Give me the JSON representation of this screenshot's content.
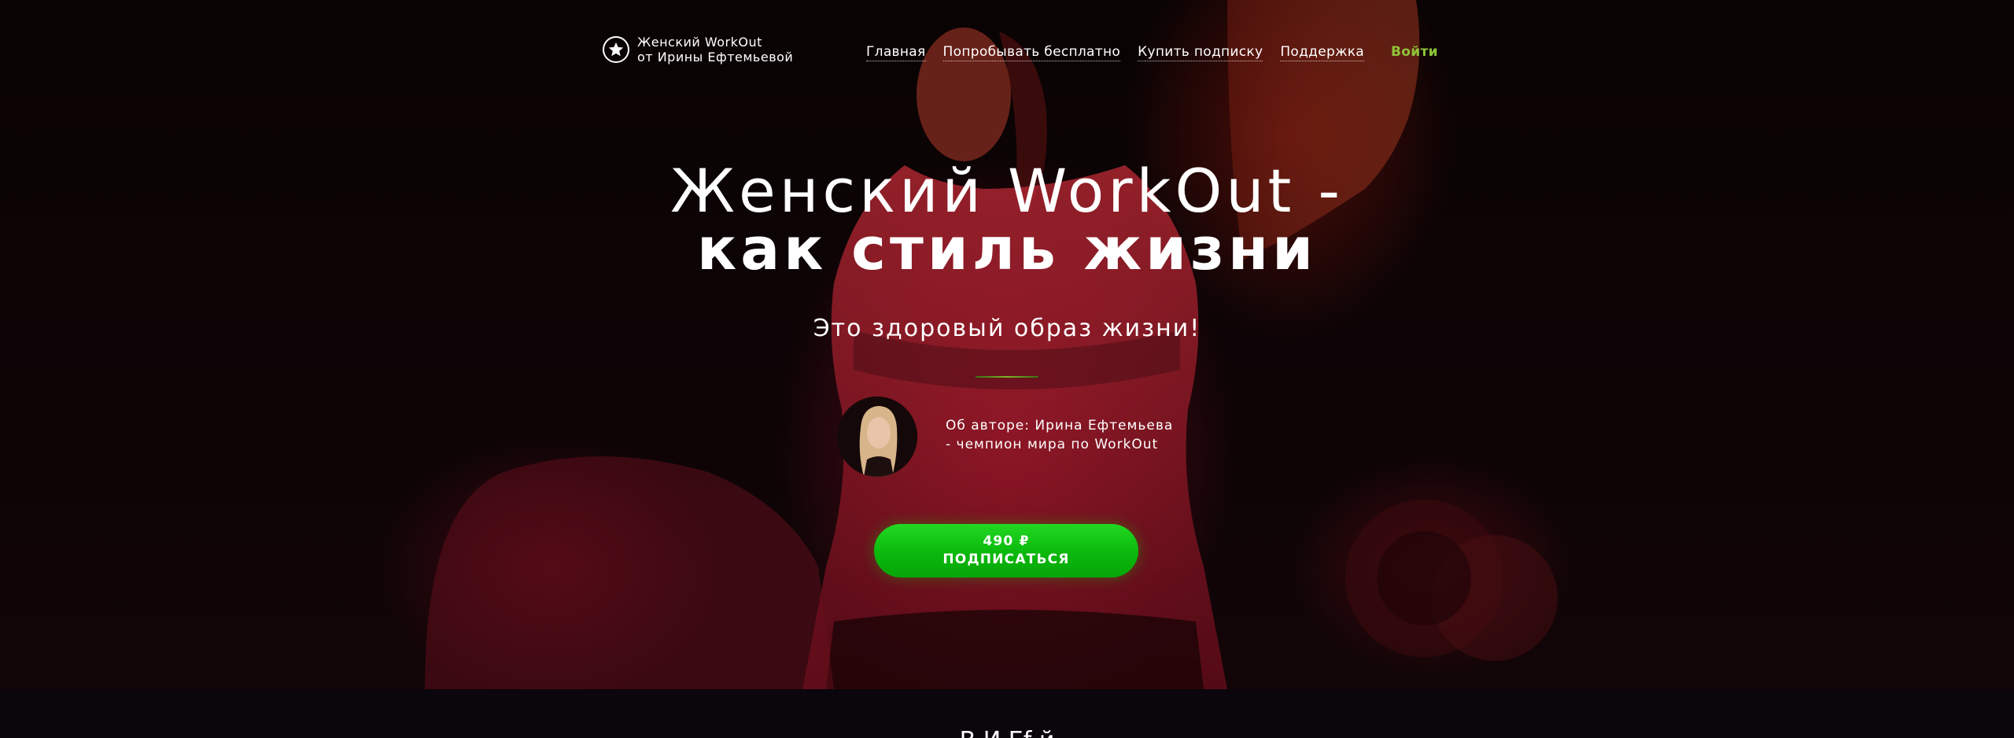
{
  "header": {
    "logo_line1": "Женский WorkOut",
    "logo_line2": "от Ирины Ефтемьевой",
    "logo_icon": "star-icon",
    "nav": [
      {
        "label": "Главная"
      },
      {
        "label": "Попробывать бесплатно"
      },
      {
        "label": "Купить подписку"
      },
      {
        "label": "Поддержка"
      }
    ],
    "login_label": "Войти"
  },
  "hero": {
    "title_line1": "Женский WorkOut -",
    "title_line2": "как стиль жизни",
    "subtitle": "Это здоровый образ жизни!",
    "author_line1": "Об авторе: Ирина Ефтемьева",
    "author_line2": "- чемпион мира по WorkOut",
    "cta_price": "490 ₽",
    "cta_label": "ПОДПИСАТЬСЯ"
  },
  "next_section": {
    "title": "В                    И         Ef            й"
  },
  "colors": {
    "accent_green": "#0ab80c",
    "login_green": "#8fc43a",
    "hero_red": "#aa142d"
  }
}
